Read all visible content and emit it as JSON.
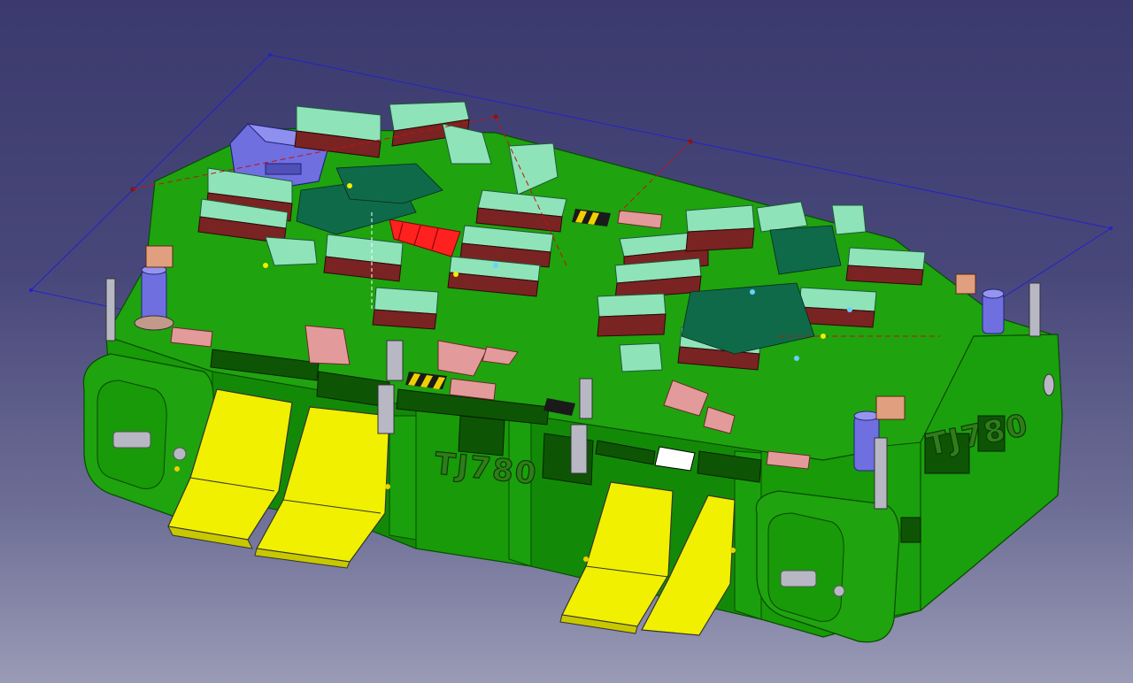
{
  "viewport": {
    "background_top": "#3b3a6e",
    "background_bottom": "#9a9bb6"
  },
  "model": {
    "part_number_front": "TJ780",
    "part_number_side": "TJ780"
  },
  "colors": {
    "base_green": "#1fa30f",
    "base_green_dark": "#127a07",
    "base_green_light": "#39c024",
    "ramp_yellow": "#f0f000",
    "clamp_mint": "#8fe3b8",
    "clamp_dark_red": "#7a2323",
    "pad_salmon": "#e39a9a",
    "locator_blue": "#6f6fe0",
    "bbox_line": "#2323c8",
    "sheet_red": "#ff2020",
    "pin_gray": "#b8b8c4"
  }
}
